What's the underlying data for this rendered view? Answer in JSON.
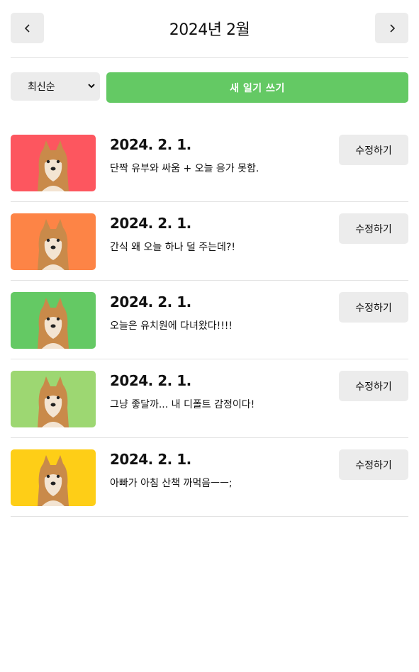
{
  "header": {
    "title": "2024년 2월",
    "prev_label": "<",
    "next_label": ">"
  },
  "controls": {
    "sort_selected": "최신순",
    "new_label": "새 일기 쓰기"
  },
  "colors": {
    "accent": "#64c964",
    "button_bg": "#ececec"
  },
  "diaries": [
    {
      "date": "2024. 2. 1.",
      "content": "단짝 유부와 싸움 + 오늘 응가 못함.",
      "edit_label": "수정하기",
      "emotion_color": "#fd565f"
    },
    {
      "date": "2024. 2. 1.",
      "content": "간식 왜 오늘 하나 덜 주는데?!",
      "edit_label": "수정하기",
      "emotion_color": "#fd8446"
    },
    {
      "date": "2024. 2. 1.",
      "content": "오늘은 유치원에 다녀왔다!!!!",
      "edit_label": "수정하기",
      "emotion_color": "#64c964"
    },
    {
      "date": "2024. 2. 1.",
      "content": "그냥 좋달까... 내 디폴트 감정이다!",
      "edit_label": "수정하기",
      "emotion_color": "#9dd772"
    },
    {
      "date": "2024. 2. 1.",
      "content": "아빠가 아침 산책 까먹음ㅡㅡ;",
      "edit_label": "수정하기",
      "emotion_color": "#fece17"
    }
  ]
}
